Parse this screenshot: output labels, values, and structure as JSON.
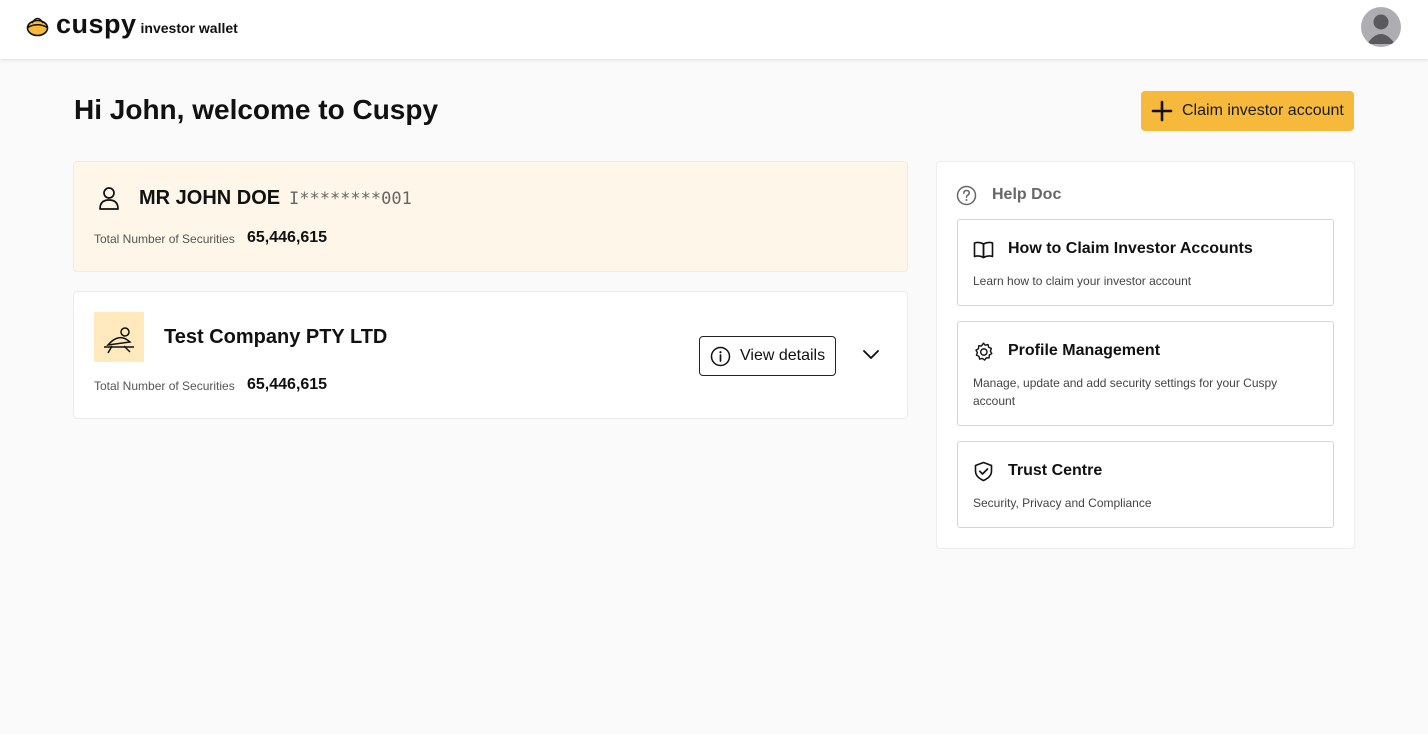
{
  "header": {
    "brand_name": "cuspy",
    "brand_sub": "investor wallet"
  },
  "main": {
    "greeting": "Hi John, welcome to Cuspy",
    "claim_button_label": "Claim investor account"
  },
  "investor": {
    "name": "MR JOHN DOE",
    "id_masked": "I********001",
    "securities_label": "Total Number of Securities",
    "securities_value": "65,446,615"
  },
  "holdings": [
    {
      "company_name": "Test Company PTY LTD",
      "securities_label": "Total Number of Securities",
      "securities_value": "65,446,615",
      "view_button_label": "View details"
    }
  ],
  "help": {
    "title": "Help Doc",
    "items": [
      {
        "icon": "book-icon",
        "title": "How to Claim Investor Accounts",
        "description": "Learn how to claim your investor account"
      },
      {
        "icon": "gear-icon",
        "title": "Profile Management",
        "description": "Manage, update and add security settings for your Cuspy account"
      },
      {
        "icon": "shield-check-icon",
        "title": "Trust Centre",
        "description": "Security, Privacy and Compliance"
      }
    ]
  },
  "colors": {
    "accent": "#f6b93b",
    "investor_card_bg": "#fff6ea",
    "company_logo_bg": "#ffe9bd"
  }
}
